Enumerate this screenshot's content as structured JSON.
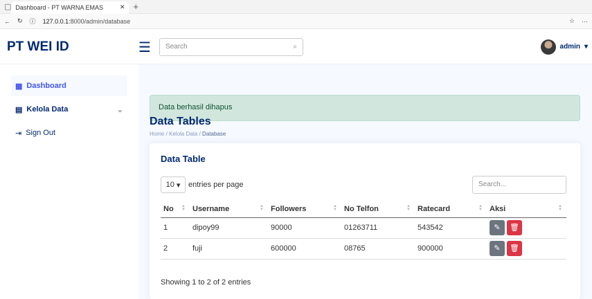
{
  "browser": {
    "tab_title": "Dashboard - PT WARNA EMAS",
    "new_tab": "+",
    "url_host": "127.0.0.1",
    "url_path": ":8000/admin/database"
  },
  "header": {
    "brand": "PT WEI ID",
    "search_placeholder": "Search",
    "user": "admin"
  },
  "sidebar": {
    "items": [
      {
        "label": "Dashboard",
        "icon": "grid-icon"
      },
      {
        "label": "Kelola Data",
        "icon": "layout-icon"
      },
      {
        "label": "Sign Out",
        "icon": "signout-icon"
      }
    ]
  },
  "alert": "Data berhasil dihapus",
  "page": {
    "title": "Data Tables",
    "crumbs": [
      "Home",
      "Kelola Data",
      "Database"
    ]
  },
  "card": {
    "title": "Data Table",
    "per_page": "10",
    "per_page_label": "entries per page",
    "search_placeholder": "Search...",
    "columns": [
      "No",
      "Username",
      "Followers",
      "No Telfon",
      "Ratecard",
      "Aksi"
    ],
    "rows": [
      [
        "1",
        "dipoy99",
        "90000",
        "01263711",
        "543542"
      ],
      [
        "2",
        "fuji",
        "600000",
        "08765",
        "900000"
      ]
    ],
    "info": "Showing 1 to 2 of 2 entries"
  },
  "colors": {
    "accent": "#4154f1",
    "brand": "#012970",
    "alert_bg": "#d1e7dd",
    "delete": "#dc3545",
    "edit": "#6c757d"
  }
}
